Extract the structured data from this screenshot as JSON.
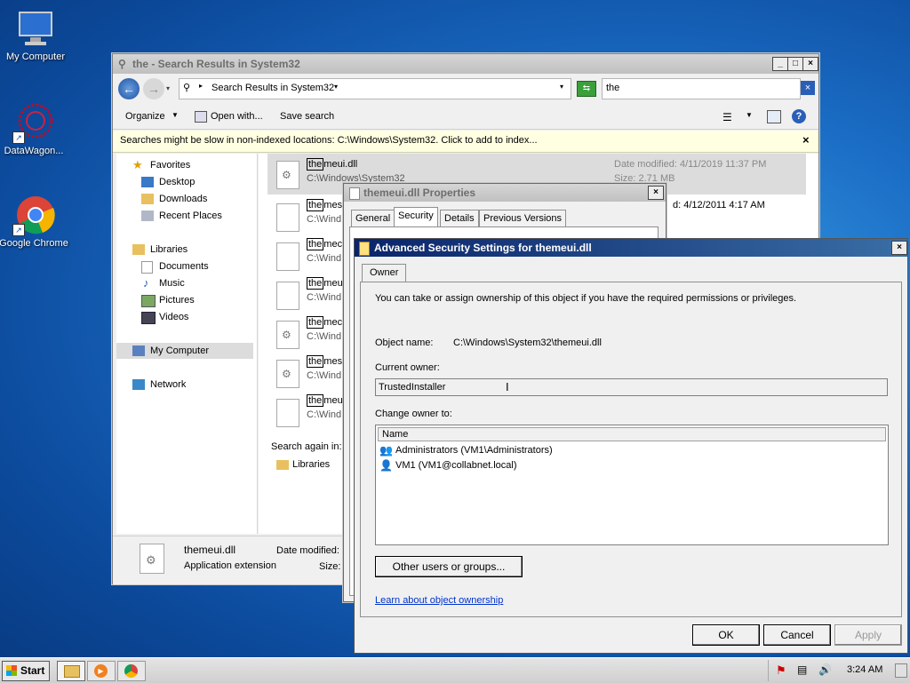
{
  "desktop": {
    "icons": [
      {
        "label": "My Computer"
      },
      {
        "label": "DataWagon..."
      },
      {
        "label": "Google Chrome"
      }
    ]
  },
  "explorer": {
    "title": "the - Search Results in System32",
    "address": "Search Results in System32",
    "search_value": "the",
    "toolbar": {
      "organize": "Organize",
      "open_with": "Open with...",
      "save_search": "Save search"
    },
    "infobar": "Searches might be slow in non-indexed locations: C:\\Windows\\System32. Click to add to index...",
    "nav": {
      "favorites": "Favorites",
      "desktop": "Desktop",
      "downloads": "Downloads",
      "recent": "Recent Places",
      "libraries": "Libraries",
      "documents": "Documents",
      "music": "Music",
      "pictures": "Pictures",
      "videos": "Videos",
      "computer": "My Computer",
      "network": "Network"
    },
    "results": [
      {
        "hl": "the",
        "rest": "meui.dll",
        "path": "C:\\Windows\\System32",
        "meta": "Date modified: 4/11/2019 11:37 PM",
        "size": "Size: 2.71 MB"
      },
      {
        "hl": "the",
        "rest": "mese",
        "path": "C:\\Wind",
        "meta": "d: 4/12/2011 4:17 AM"
      },
      {
        "hl": "the",
        "rest": "mecp",
        "path": "C:\\Wind"
      },
      {
        "hl": "the",
        "rest": "meui",
        "path": "C:\\Wind"
      },
      {
        "hl": "the",
        "rest": "mecp",
        "path": "C:\\Wind"
      },
      {
        "hl": "the",
        "rest": "mese",
        "path": "C:\\Wind"
      },
      {
        "hl": "the",
        "rest": "meui",
        "path": "C:\\Wind"
      }
    ],
    "search_again": "Search again in:",
    "search_again_libraries": "Libraries",
    "details": {
      "name": "themeui.dll",
      "type": "Application extension",
      "date_label": "Date modified:",
      "size_label": "Size:"
    }
  },
  "properties": {
    "title": "themeui.dll Properties",
    "tabs": [
      "General",
      "Security",
      "Details",
      "Previous Versions"
    ]
  },
  "advanced": {
    "title": "Advanced Security Settings for themeui.dll",
    "tab": "Owner",
    "intro": "You can take or assign ownership of this object if you have the required permissions or privileges.",
    "object_label": "Object name:",
    "object_value": "C:\\Windows\\System32\\themeui.dll",
    "current_owner_label": "Current owner:",
    "current_owner_value": "TrustedInstaller",
    "change_owner_label": "Change owner to:",
    "list_header": "Name",
    "owners": [
      "Administrators (VM1\\Administrators)",
      "VM1 (VM1@collabnet.local)"
    ],
    "other_users_btn": "Other users or groups...",
    "learn_link": "Learn about object ownership",
    "ok": "OK",
    "cancel": "Cancel",
    "apply": "Apply"
  },
  "taskbar": {
    "start": "Start",
    "time": "3:24 AM"
  }
}
